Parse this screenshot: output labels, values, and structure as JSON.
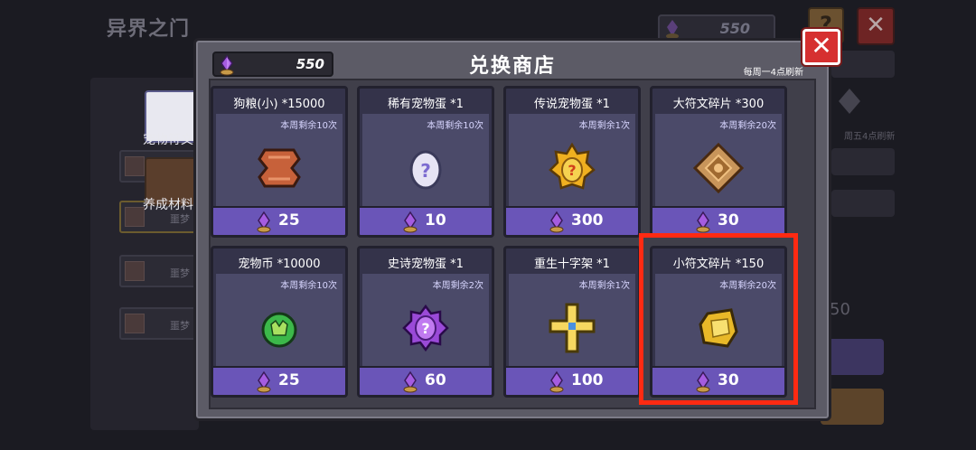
{
  "background": {
    "title": "异界之门",
    "currency_amount": "550",
    "help_label": "?",
    "close_label": "✕",
    "side_labels": [
      "宠物符文",
      "养成材料"
    ],
    "tab_label": "噩梦",
    "weekly_note": "周五4点刷新",
    "partial_value": "50"
  },
  "modal": {
    "title": "兑换商店",
    "currency_amount": "550",
    "refresh_note": "每周一4点刷新",
    "close_label": "✕"
  },
  "items": [
    {
      "name": "狗粮(小) *15000",
      "remaining": "本周剩余10次",
      "price": "25",
      "icon": "dog-food-icon"
    },
    {
      "name": "稀有宠物蛋 *1",
      "remaining": "本周剩余10次",
      "price": "10",
      "icon": "rare-pet-egg-icon"
    },
    {
      "name": "传说宠物蛋 *1",
      "remaining": "本周剩余1次",
      "price": "300",
      "icon": "legendary-pet-egg-icon"
    },
    {
      "name": "大符文碎片 *300",
      "remaining": "本周剩余20次",
      "price": "30",
      "icon": "large-rune-shard-icon"
    },
    {
      "name": "宠物币 *10000",
      "remaining": "本周剩余10次",
      "price": "25",
      "icon": "pet-coin-icon"
    },
    {
      "name": "史诗宠物蛋 *1",
      "remaining": "本周剩余2次",
      "price": "60",
      "icon": "epic-pet-egg-icon"
    },
    {
      "name": "重生十字架 *1",
      "remaining": "本周剩余1次",
      "price": "100",
      "icon": "rebirth-cross-icon"
    },
    {
      "name": "小符文碎片 *150",
      "remaining": "本周剩余20次",
      "price": "30",
      "icon": "small-rune-shard-icon"
    }
  ],
  "colors": {
    "accent_purple": "#6a55b8",
    "close_red": "#d63030",
    "highlight": "#ff2a12"
  }
}
